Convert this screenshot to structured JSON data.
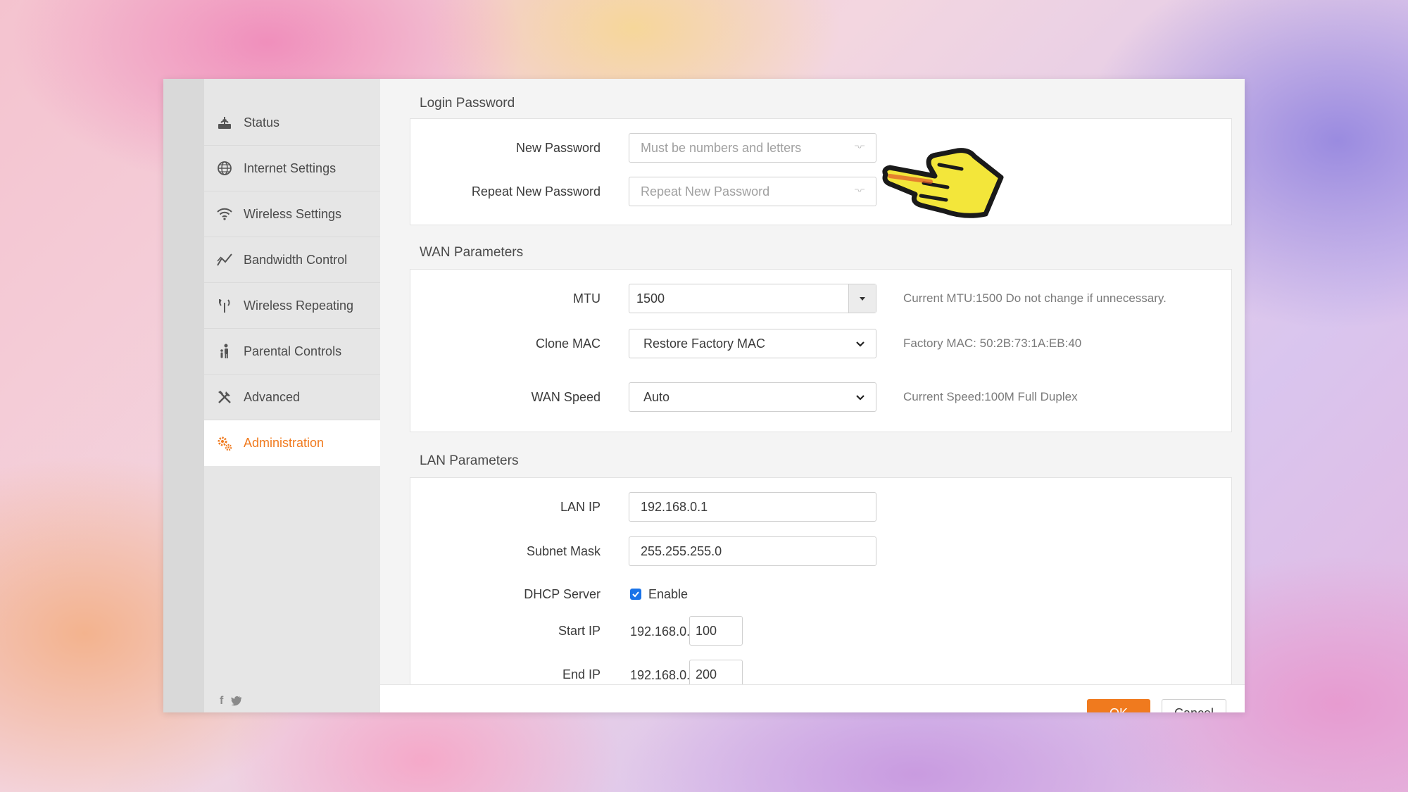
{
  "sidebar": {
    "items": [
      {
        "label": "Status",
        "icon": "router-icon"
      },
      {
        "label": "Internet Settings",
        "icon": "globe-icon"
      },
      {
        "label": "Wireless Settings",
        "icon": "wifi-icon"
      },
      {
        "label": "Bandwidth Control",
        "icon": "chart-line-icon"
      },
      {
        "label": "Wireless Repeating",
        "icon": "antenna-icon"
      },
      {
        "label": "Parental Controls",
        "icon": "family-icon"
      },
      {
        "label": "Advanced",
        "icon": "tools-icon"
      },
      {
        "label": "Administration",
        "icon": "gears-icon",
        "active": true
      }
    ],
    "social": {
      "facebook": "f",
      "twitter": "🐦"
    }
  },
  "login_password": {
    "title": "Login Password",
    "new_password_label": "New Password",
    "new_password_placeholder": "Must be numbers and letters",
    "repeat_password_label": "Repeat New Password",
    "repeat_password_placeholder": "Repeat New Password"
  },
  "wan": {
    "title": "WAN Parameters",
    "mtu_label": "MTU",
    "mtu_value": "1500",
    "mtu_hint": "Current MTU:1500 Do not change if unnecessary.",
    "clone_mac_label": "Clone MAC",
    "clone_mac_value": "Restore Factory MAC",
    "clone_mac_hint": "Factory MAC: 50:2B:73:1A:EB:40",
    "wan_speed_label": "WAN Speed",
    "wan_speed_value": "Auto",
    "wan_speed_hint": "Current Speed:100M Full Duplex"
  },
  "lan": {
    "title": "LAN Parameters",
    "lan_ip_label": "LAN IP",
    "lan_ip_value": "192.168.0.1",
    "subnet_mask_label": "Subnet Mask",
    "subnet_mask_value": "255.255.255.0",
    "dhcp_label": "DHCP Server",
    "dhcp_enable_label": "Enable",
    "dhcp_enabled": true,
    "start_ip_label": "Start IP",
    "start_ip_prefix": "192.168.0.",
    "start_ip_value": "100",
    "end_ip_label": "End IP",
    "end_ip_prefix": "192.168.0.",
    "end_ip_value": "200"
  },
  "footer": {
    "ok_label": "OK",
    "cancel_label": "Cancel"
  },
  "colors": {
    "accent": "#f07a1e",
    "checkbox": "#1a73e8"
  }
}
